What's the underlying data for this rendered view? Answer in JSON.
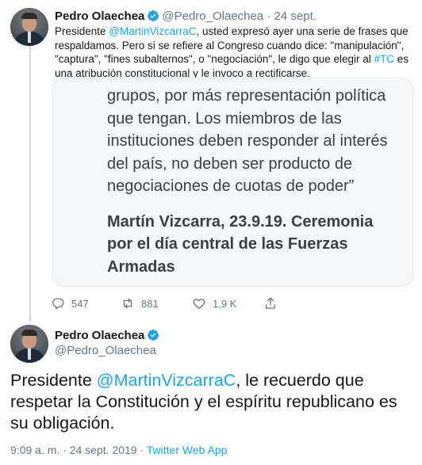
{
  "tweet1": {
    "author_name": "Pedro Olaechea",
    "handle": "@Pedro_Olaechea",
    "separator": "·",
    "date": "24 sept.",
    "text_before_mention": "Presidente ",
    "mention": "@MartinVizcarraC",
    "text_after_mention": ", usted expresó ayer una serie de frases que respaldamos. Pero si se refiere al Congreso cuando dice: \"manipulación\", \"captura\", \"fines subalternos\", o \"negociación\", le digo que elegir al ",
    "hashtag": "#TC",
    "text_end": " es una atribución constitucional y le invoco a rectificarse.",
    "quote_image": {
      "body_lines": [
        "grupos, por más representación política",
        "que tengan. Los miembros de las",
        "instituciones deben responder al interés",
        "del país, no deben ser producto de",
        "negociaciones de cuotas de poder”"
      ],
      "signature_lines": [
        "Martín Vizcarra, 23.9.19. Ceremonia",
        "por el día central de las Fuerzas",
        "Armadas"
      ]
    },
    "actions": {
      "replies": "547",
      "retweets": "881",
      "likes": "1,9 K"
    }
  },
  "tweet2": {
    "author_name": "Pedro Olaechea",
    "handle": "@Pedro_Olaechea",
    "text_before_mention": "Presidente ",
    "mention": "@MartinVizcarraC",
    "text_after_mention": ", le recuerdo que respetar la Constitución y el espíritu republicano es su obligación.",
    "time": "9:09 a. m.",
    "separator": "·",
    "date": "24 sept. 2019",
    "source": "Twitter Web App"
  },
  "colors": {
    "link": "#1da1f2",
    "muted": "#657786",
    "text": "#14171a",
    "verified": "#1da1f2"
  },
  "icons": [
    "avatar",
    "verified-badge-icon",
    "reply-icon",
    "retweet-icon",
    "like-icon",
    "share-icon"
  ]
}
